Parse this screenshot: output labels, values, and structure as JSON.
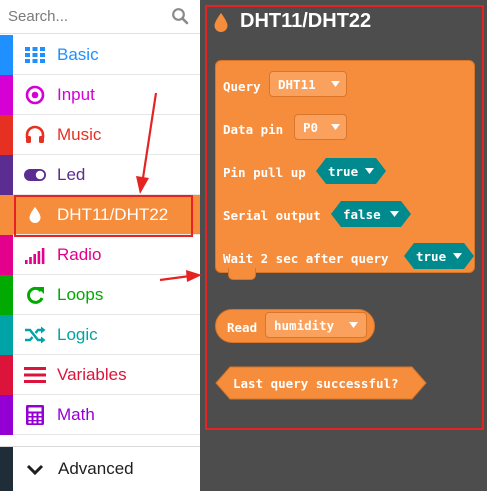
{
  "search": {
    "placeholder": "Search..."
  },
  "categories": [
    {
      "label": "Basic",
      "icon": "grid-icon",
      "color": "#1e90ff"
    },
    {
      "label": "Input",
      "icon": "input-circle-icon",
      "color": "#d400d4"
    },
    {
      "label": "Music",
      "icon": "headphones-icon",
      "color": "#e63022"
    },
    {
      "label": "Led",
      "icon": "toggle-icon",
      "color": "#5c2d91"
    },
    {
      "label": "DHT11/DHT22",
      "icon": "droplet-icon",
      "color": "#f58d3c",
      "selected": true
    },
    {
      "label": "Radio",
      "icon": "signal-bars-icon",
      "color": "#e3008c"
    },
    {
      "label": "Loops",
      "icon": "refresh-icon",
      "color": "#00aa00"
    },
    {
      "label": "Logic",
      "icon": "shuffle-icon",
      "color": "#00a4a6"
    },
    {
      "label": "Variables",
      "icon": "list-lines-icon",
      "color": "#dc143c"
    },
    {
      "label": "Math",
      "icon": "calculator-icon",
      "color": "#9400d3"
    }
  ],
  "advanced": {
    "label": "Advanced",
    "icon": "chevron-down-icon"
  },
  "flyout": {
    "title": "DHT11/DHT22",
    "title_icon": "droplet-icon",
    "query_block": {
      "query_label": "Query",
      "sensor_value": "DHT11",
      "data_pin_label": "Data pin",
      "data_pin_value": "P0",
      "pull_up_label": "Pin pull up",
      "pull_up_value": "true",
      "serial_label": "Serial output",
      "serial_value": "false",
      "wait_label": "Wait 2 sec after query",
      "wait_value": "true"
    },
    "read_block": {
      "read_label": "Read",
      "read_value": "humidity"
    },
    "success_block": {
      "label": "Last query successful?"
    }
  },
  "colors": {
    "dht_orange": "#f58d3c",
    "boolean_teal": "#008a8e",
    "flyout_bg": "#4d4d4d",
    "annotation_red": "#e52323"
  }
}
